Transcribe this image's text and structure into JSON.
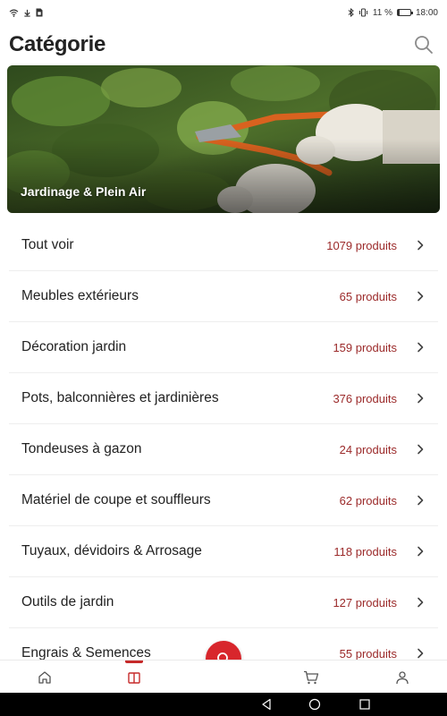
{
  "status_bar": {
    "battery": "11 %",
    "time": "18:00",
    "battery_level": 0.11
  },
  "header": {
    "title": "Catégorie"
  },
  "banner": {
    "title": "Jardinage & Plein Air"
  },
  "categories": [
    {
      "name": "Tout voir",
      "count": "1079 produits"
    },
    {
      "name": "Meubles extérieurs",
      "count": "65 produits"
    },
    {
      "name": "Décoration jardin",
      "count": "159 produits"
    },
    {
      "name": "Pots, balconnières et jardinières",
      "count": "376 produits"
    },
    {
      "name": "Tondeuses à gazon",
      "count": "24 produits"
    },
    {
      "name": "Matériel de coupe et souffleurs",
      "count": "62 produits"
    },
    {
      "name": "Tuyaux, dévidoirs & Arrosage",
      "count": "118 produits"
    },
    {
      "name": "Outils de jardin",
      "count": "127 produits"
    },
    {
      "name": "Engrais & Semences",
      "count": "55 produits"
    }
  ],
  "bottom_nav": {
    "items": [
      "home-icon",
      "catalog-icon",
      "search-icon",
      "cart-icon",
      "user-icon"
    ],
    "active": "catalog-icon"
  },
  "colors": {
    "accent": "#d8262c",
    "count_text": "#9b2a2a"
  }
}
